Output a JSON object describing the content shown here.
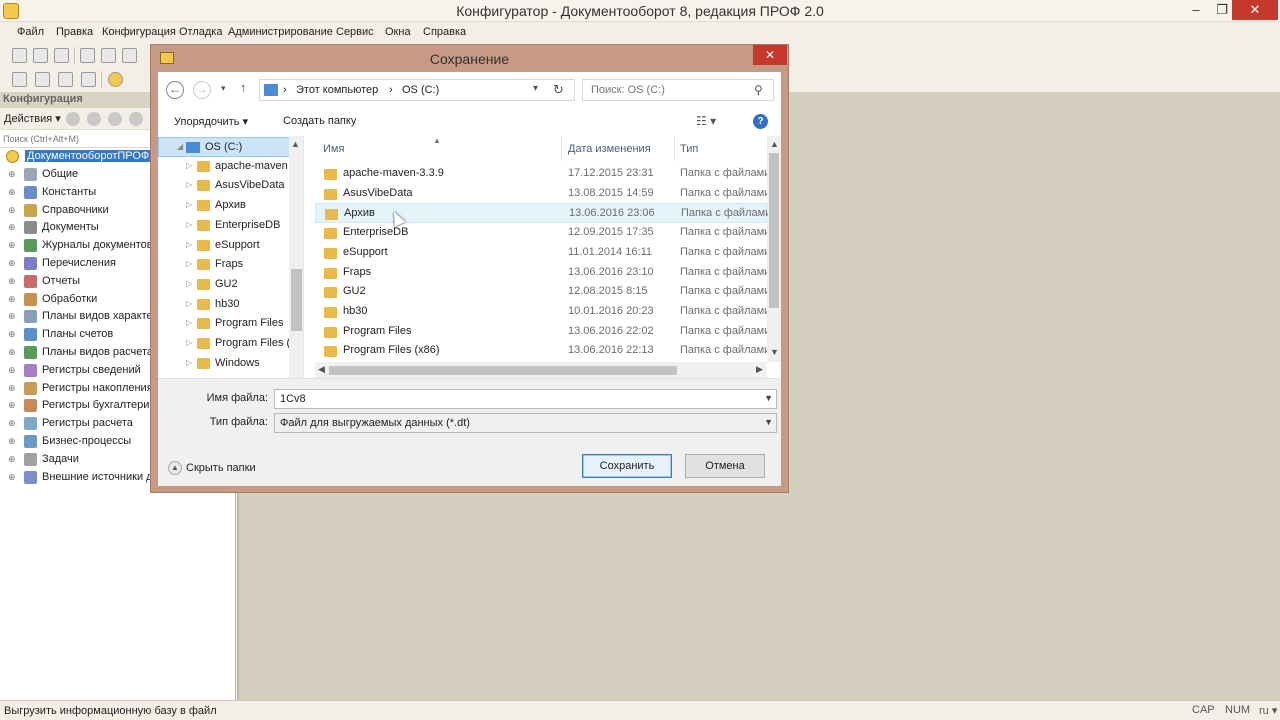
{
  "window": {
    "title": "Конфигуратор - Документооборот 8, редакция ПРОФ 2.0",
    "controls": {
      "minimize": "–",
      "maximize": "❐",
      "close": "✕"
    }
  },
  "menu": [
    "Файл",
    "Правка",
    "Конфигурация",
    "Отладка",
    "Администрирование",
    "Сервис",
    "Окна",
    "Справка"
  ],
  "config_panel": {
    "header": "Конфигурация",
    "actions_label": "Действия ▾",
    "search_placeholder": "Поиск (Ctrl+Alt+M)",
    "root": "ДокументооборотПРОФ",
    "items": [
      {
        "label": "Общие",
        "icon": "common-icon"
      },
      {
        "label": "Константы",
        "icon": "constants-icon"
      },
      {
        "label": "Справочники",
        "icon": "catalogs-icon"
      },
      {
        "label": "Документы",
        "icon": "documents-icon"
      },
      {
        "label": "Журналы документов",
        "icon": "journals-icon"
      },
      {
        "label": "Перечисления",
        "icon": "enums-icon"
      },
      {
        "label": "Отчеты",
        "icon": "reports-icon"
      },
      {
        "label": "Обработки",
        "icon": "processing-icon"
      },
      {
        "label": "Планы видов характеристик",
        "icon": "chart-types-icon"
      },
      {
        "label": "Планы счетов",
        "icon": "accounts-icon"
      },
      {
        "label": "Планы видов расчета",
        "icon": "calc-types-icon"
      },
      {
        "label": "Регистры сведений",
        "icon": "info-registers-icon"
      },
      {
        "label": "Регистры накопления",
        "icon": "accum-registers-icon"
      },
      {
        "label": "Регистры бухгалтерии",
        "icon": "accounting-registers-icon"
      },
      {
        "label": "Регистры расчета",
        "icon": "calc-registers-icon"
      },
      {
        "label": "Бизнес-процессы",
        "icon": "business-process-icon"
      },
      {
        "label": "Задачи",
        "icon": "tasks-icon"
      },
      {
        "label": "Внешние источники данных",
        "icon": "external-sources-icon"
      }
    ]
  },
  "status_bar": {
    "message": "Выгрузить информационную базу в файл",
    "cap": "CAP",
    "num": "NUM",
    "lang": "ru ▾"
  },
  "dialog": {
    "title": "Сохранение",
    "close": "✕",
    "address": {
      "crumbs": [
        "›",
        "Этот компьютер",
        "›",
        "OS (C:)"
      ],
      "search_placeholder": "Поиск: OS (C:)"
    },
    "commands": {
      "organize": "Упорядочить ▾",
      "new_folder": "Создать папку"
    },
    "nav_tree": [
      {
        "label": "OS (C:)",
        "selected": true
      },
      {
        "label": "apache-maven"
      },
      {
        "label": "AsusVibeData"
      },
      {
        "label": "Архив"
      },
      {
        "label": "EnterpriseDB"
      },
      {
        "label": "eSupport"
      },
      {
        "label": "Fraps"
      },
      {
        "label": "GU2"
      },
      {
        "label": "hb30"
      },
      {
        "label": "Program Files"
      },
      {
        "label": "Program Files ("
      },
      {
        "label": "Windows"
      }
    ],
    "columns": {
      "name": "Имя",
      "date": "Дата изменения",
      "type": "Тип"
    },
    "files": [
      {
        "name": "apache-maven-3.3.9",
        "date": "17.12.2015 23:31",
        "type": "Папка с файлами"
      },
      {
        "name": "AsusVibeData",
        "date": "13.08.2015 14:59",
        "type": "Папка с файлами"
      },
      {
        "name": "Архив",
        "date": "13.06.2016 23:06",
        "type": "Папка с файлами"
      },
      {
        "name": "EnterpriseDB",
        "date": "12.09.2015 17:35",
        "type": "Папка с файлами"
      },
      {
        "name": "eSupport",
        "date": "11.01.2014 16:11",
        "type": "Папка с файлами"
      },
      {
        "name": "Fraps",
        "date": "13.06.2016 23:10",
        "type": "Папка с файлами"
      },
      {
        "name": "GU2",
        "date": "12.08.2015 8:15",
        "type": "Папка с файлами"
      },
      {
        "name": "hb30",
        "date": "10.01.2016 20:23",
        "type": "Папка с файлами"
      },
      {
        "name": "Program Files",
        "date": "13.06.2016 22:02",
        "type": "Папка с файлами"
      },
      {
        "name": "Program Files (x86)",
        "date": "13.06.2016 22:13",
        "type": "Папка с файлами"
      }
    ],
    "filename_label": "Имя файла:",
    "filename_value": "1Cv8",
    "filetype_label": "Тип файла:",
    "filetype_value": "Файл для выгружаемых данных (*.dt)",
    "hide_folders": "Скрыть папки",
    "save_button": "Сохранить",
    "cancel_button": "Отмена"
  }
}
